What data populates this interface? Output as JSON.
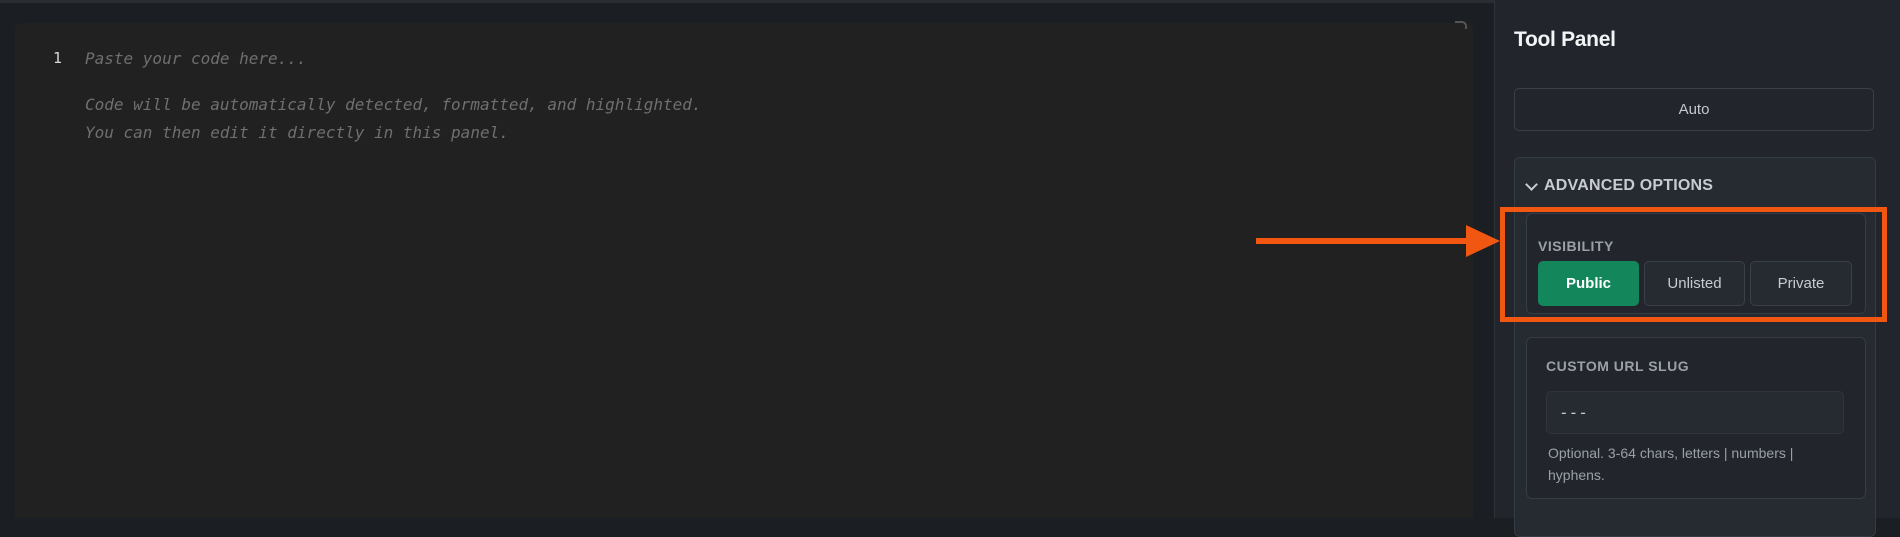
{
  "editor": {
    "line_number": "1",
    "lines": [
      "Paste your code here...",
      "",
      "Code will be automatically detected, formatted, and highlighted.",
      "You can then edit it directly in this panel."
    ]
  },
  "panel": {
    "title": "Tool Panel",
    "language_select": "Auto",
    "advanced": {
      "label": "ADVANCED OPTIONS",
      "visibility": {
        "label": "VISIBILITY",
        "options": [
          "Public",
          "Unlisted",
          "Private"
        ],
        "selected": "Public"
      },
      "slug": {
        "label": "CUSTOM URL SLUG",
        "placeholder": "---",
        "help": "Optional. 3-64 chars, letters | numbers | hyphens."
      }
    }
  },
  "colors": {
    "accent_green": "#13875b",
    "annotation_orange": "#f25712",
    "editor_bg": "#212121",
    "panel_bg": "#22262c"
  }
}
